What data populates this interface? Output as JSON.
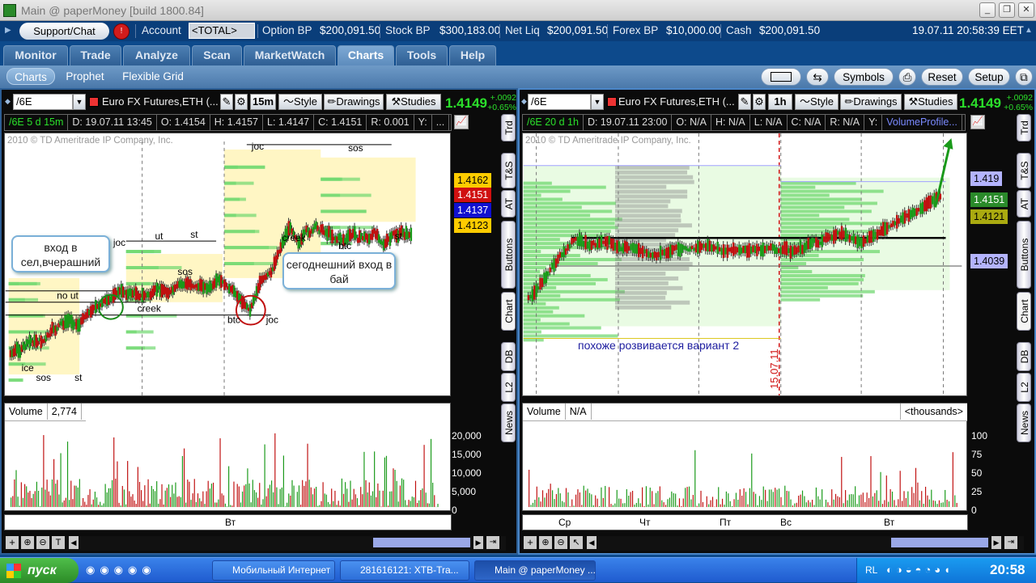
{
  "window": {
    "title": "Main @ paperMoney [build 1800.84]"
  },
  "account_bar": {
    "support_label": "Support/Chat",
    "account_label": "Account",
    "account_value": "<TOTAL>",
    "option_bp_label": "Option BP",
    "option_bp": "$200,091.50",
    "stock_bp_label": "Stock BP",
    "stock_bp": "$300,183.00",
    "net_liq_label": "Net Liq",
    "net_liq": "$200,091.50",
    "forex_bp_label": "Forex BP",
    "forex_bp": "$10,000.00",
    "cash_label": "Cash",
    "cash": "$200,091.50",
    "datetime": "19.07.11 20:58:39 EET"
  },
  "main_tabs": [
    "Monitor",
    "Trade",
    "Analyze",
    "Scan",
    "MarketWatch",
    "Charts",
    "Tools",
    "Help"
  ],
  "active_tab": "Charts",
  "sub_tabs": [
    "Charts",
    "Prophet",
    "Flexible Grid"
  ],
  "sub_buttons": {
    "symbols": "Symbols",
    "reset": "Reset",
    "setup": "Setup"
  },
  "left_chart": {
    "symbol": "/6E",
    "title": "Euro FX Futures,ETH (...",
    "period": "15m",
    "style": "Style",
    "drawings": "Drawings",
    "studies": "Studies",
    "last": "1.4149",
    "chg_abs": "+.0092",
    "chg_pct": "+0.65%",
    "ohlc": {
      "sym": "/6E 5 d 15m",
      "date": "D: 19.07.11 13:45",
      "o": "O: 1.4154",
      "h": "H: 1.4157",
      "l": "L: 1.4147",
      "c": "C: 1.4151",
      "r": "R: 0.001",
      "y": "Y:"
    },
    "copyright": "2010 © TD Ameritrade IP Company, Inc.",
    "price_labels": [
      {
        "v": "1.4162",
        "bg": "#ffcc00",
        "fg": "#000"
      },
      {
        "v": "1.4151",
        "bg": "#d01010",
        "fg": "#fff"
      },
      {
        "v": "1.4137",
        "bg": "#1010d0",
        "fg": "#fff"
      },
      {
        "v": "1.4123",
        "bg": "#ffcc00",
        "fg": "#000"
      }
    ],
    "annotations": {
      "a1": "вход в сел,вчерашний",
      "a2": "сегоднешний вход в бай"
    },
    "labels": [
      "joc",
      "sos",
      "st",
      "joc",
      "ut",
      "st",
      "sos",
      "creek",
      "btc",
      "st",
      "no ut",
      "creek",
      "btc",
      "joc",
      "ice",
      "sos",
      "st"
    ],
    "volume_label": "Volume",
    "volume_value": "2,774",
    "vol_ticks": [
      "20,000",
      "15,000",
      "10,000",
      "5,000",
      "0"
    ],
    "xlabel": "Вт",
    "side_tabs": [
      "Trd",
      "T&S",
      "AT",
      "Buttons",
      "Chart",
      "DB",
      "L2",
      "News"
    ]
  },
  "right_chart": {
    "symbol": "/6E",
    "title": "Euro FX Futures,ETH (...",
    "period": "1h",
    "style": "Style",
    "drawings": "Drawings",
    "studies": "Studies",
    "last": "1.4149",
    "chg_abs": "+.0092",
    "chg_pct": "+0.65%",
    "ohlc": {
      "sym": "/6E 20 d 1h",
      "date": "D: 19.07.11 23:00",
      "o": "O: N/A",
      "h": "H: N/A",
      "l": "L: N/A",
      "c": "C: N/A",
      "r": "R: N/A",
      "y": "Y:",
      "extra": "VolumeProfile..."
    },
    "copyright": "2010 © TD Ameritrade IP Company, Inc.",
    "price_labels": [
      {
        "v": "1.419",
        "bg": "#b4b4ff",
        "fg": "#000"
      },
      {
        "v": "1.4151",
        "bg": "#2a8a2a",
        "fg": "#fff"
      },
      {
        "v": "1.4121",
        "bg": "#aaaa10",
        "fg": "#000"
      },
      {
        "v": "1.4039",
        "bg": "#b4b4ff",
        "fg": "#000"
      }
    ],
    "note": "похоже розвивается вариант 2",
    "date_marker": "15.07.11",
    "volume_label": "Volume",
    "volume_value": "N/A",
    "volume_unit": "<thousands>",
    "vol_ticks": [
      "100",
      "75",
      "50",
      "25",
      "0"
    ],
    "xlabels": [
      "Ср",
      "Чт",
      "Пт",
      "Вс",
      "Вт"
    ],
    "side_tabs": [
      "Trd",
      "T&S",
      "AT",
      "Buttons",
      "Chart",
      "DB",
      "L2",
      "News"
    ]
  },
  "taskbar": {
    "start": "пуск",
    "items": [
      "Мобильный Интернет",
      "281616121: XTB-Tra...",
      "Main @ paperMoney ..."
    ],
    "tray_lang": "RL",
    "clock": "20:58"
  }
}
